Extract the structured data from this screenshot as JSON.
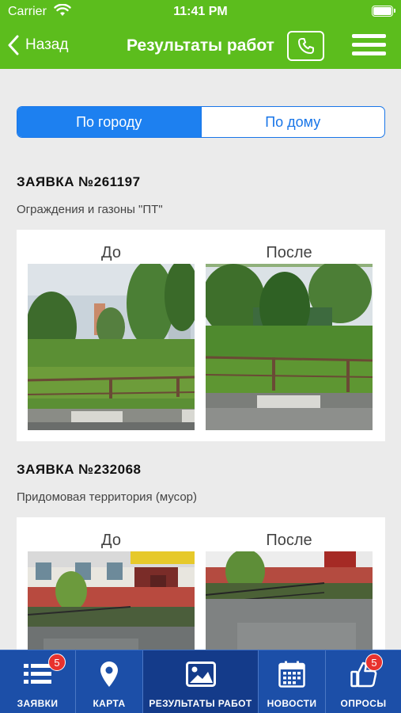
{
  "status_bar": {
    "carrier": "Carrier",
    "time": "11:41 PM"
  },
  "nav": {
    "back_label": "Назад",
    "title": "Результаты работ"
  },
  "segment": {
    "options": [
      "По городу",
      "По дому"
    ],
    "selected": 0
  },
  "requests": [
    {
      "title": "ЗАЯВКА №261197",
      "category": "Ограждения и газоны \"ПТ\"",
      "before_label": "До",
      "after_label": "После"
    },
    {
      "title": "ЗАЯВКА №232068",
      "category": "Придомовая территория (мусор)",
      "before_label": "До",
      "after_label": "После"
    }
  ],
  "tabbar": {
    "items": [
      {
        "label": "ЗАЯВКИ",
        "icon": "list-icon",
        "badge": "5"
      },
      {
        "label": "КАРТА",
        "icon": "map-pin-icon"
      },
      {
        "label": "РЕЗУЛЬТАТЫ РАБОТ",
        "icon": "image-icon",
        "active": true
      },
      {
        "label": "НОВОСТИ",
        "icon": "calendar-icon"
      },
      {
        "label": "ОПРОСЫ",
        "icon": "thumbs-up-icon",
        "badge": "5"
      }
    ]
  },
  "colors": {
    "header": "#5cbd1d",
    "accent": "#1d80f0",
    "tabbar": "#1c4fa8",
    "badge": "#e8322e"
  }
}
